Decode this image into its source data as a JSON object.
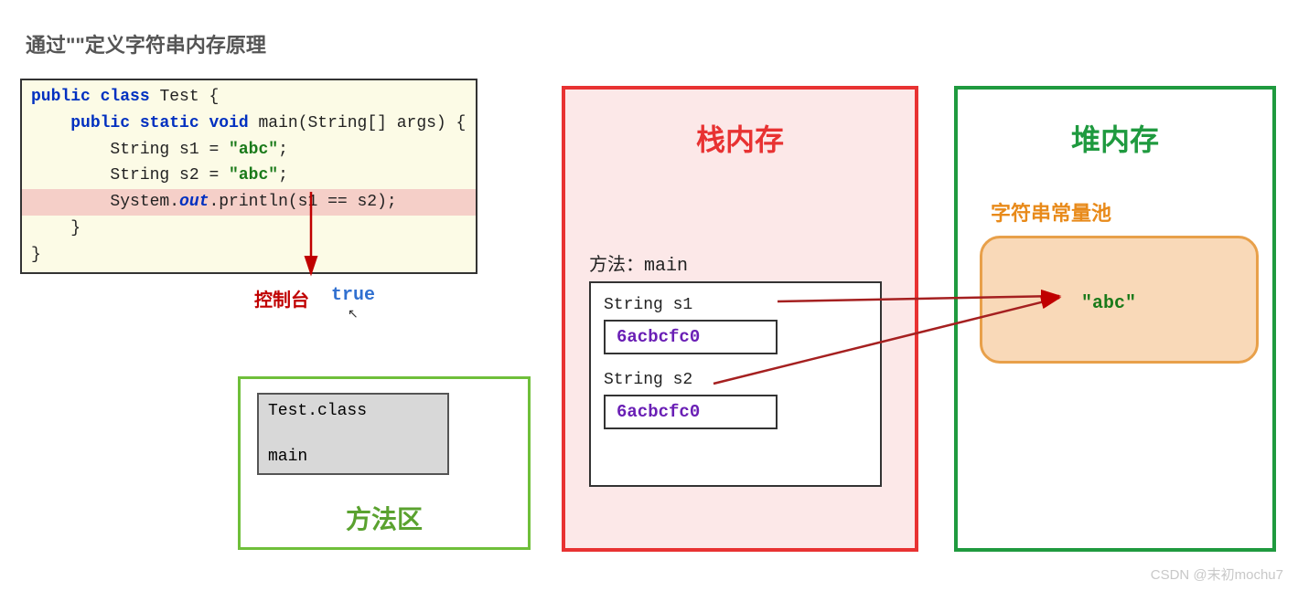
{
  "title": "通过\"\"定义字符串内存原理",
  "code": {
    "l1_kw1": "public",
    "l1_kw2": "class",
    "l1_name": "Test {",
    "l2_kw1": "public",
    "l2_kw2": "static",
    "l2_kw3": "void",
    "l2_rest": "main(String[] args) {",
    "l3_pre": "String s1 = ",
    "l3_str": "\"abc\"",
    "l3_post": ";",
    "l4_pre": "String s2 = ",
    "l4_str": "\"abc\"",
    "l4_post": ";",
    "l5_pre": "System.",
    "l5_out": "out",
    "l5_post": ".println(s1 == s2);",
    "l6": "}",
    "l7": "}"
  },
  "console": {
    "label": "控制台",
    "value": "true"
  },
  "method_area": {
    "title": "方法区",
    "class_name": "Test.class",
    "method_name": "main"
  },
  "stack": {
    "title": "栈内存",
    "method_label": "方法：main",
    "s1_label": "String s1",
    "s1_addr": "6acbcfc0",
    "s2_label": "String s2",
    "s2_addr": "6acbcfc0"
  },
  "heap": {
    "title": "堆内存",
    "pool_label": "字符串常量池",
    "abc": "\"abc\""
  },
  "watermark": "CSDN @末初mochu7"
}
